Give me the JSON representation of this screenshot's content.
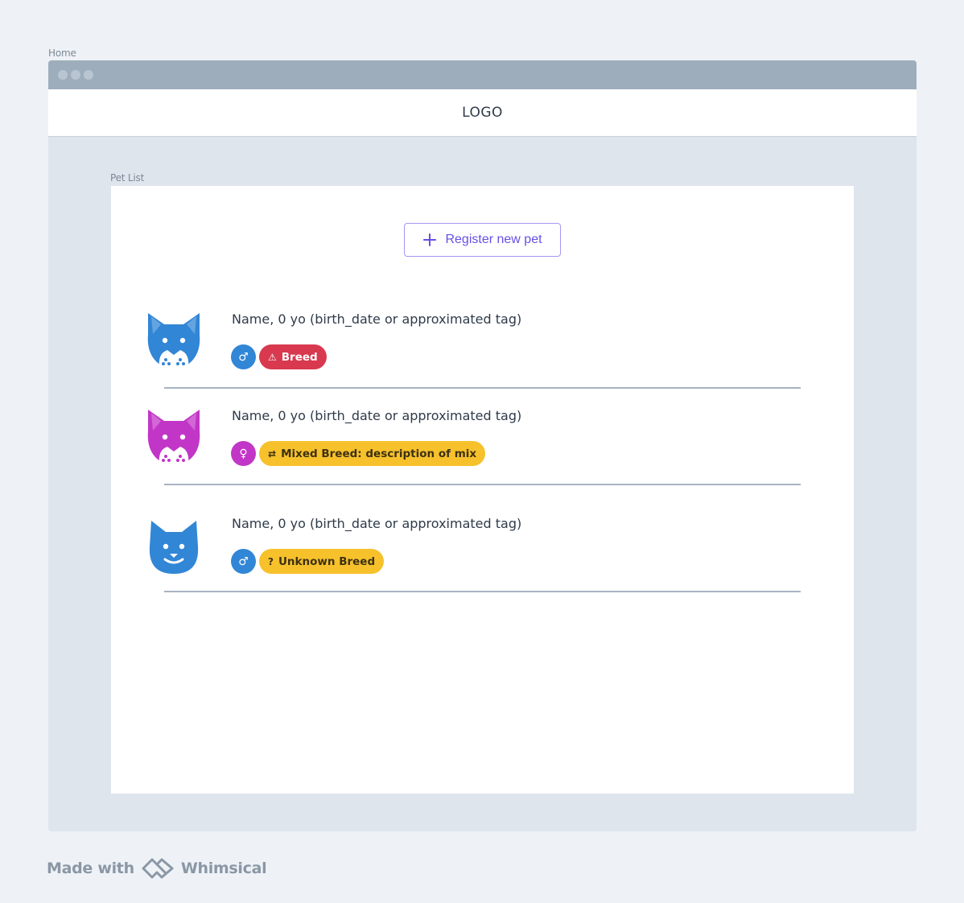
{
  "frames": {
    "home_label": "Home",
    "petlist_label": "Pet List"
  },
  "header": {
    "logo": "LOGO"
  },
  "register_button": {
    "label": "Register new pet",
    "icon": "plus-icon"
  },
  "pets": [
    {
      "avatar": "dog-icon",
      "avatar_color": "#3186d6",
      "name_line": "Name, 0 yo (birth_date or approximated tag)",
      "gender_symbol": "♂",
      "gender_color": "#3186d6",
      "breed_icon": "⚠",
      "breed_label": "Breed",
      "breed_bg": "#d8394f",
      "breed_fg": "#ffffff"
    },
    {
      "avatar": "dog-icon",
      "avatar_color": "#c236c7",
      "name_line": "Name, 0 yo (birth_date or approximated tag)",
      "gender_symbol": "♀",
      "gender_color": "#c236c7",
      "breed_icon": "⇄",
      "breed_label": "Mixed Breed: description of mix",
      "breed_bg": "#f7c12c",
      "breed_fg": "#3d3110"
    },
    {
      "avatar": "cat-icon",
      "avatar_color": "#3186d6",
      "name_line": "Name, 0 yo (birth_date or approximated tag)",
      "gender_symbol": "♂",
      "gender_color": "#3186d6",
      "breed_icon": "?",
      "breed_label": "Unknown Breed",
      "breed_bg": "#f7c12c",
      "breed_fg": "#3d3110"
    }
  ],
  "footer": {
    "made_with": "Made with",
    "brand": "Whimsical"
  }
}
